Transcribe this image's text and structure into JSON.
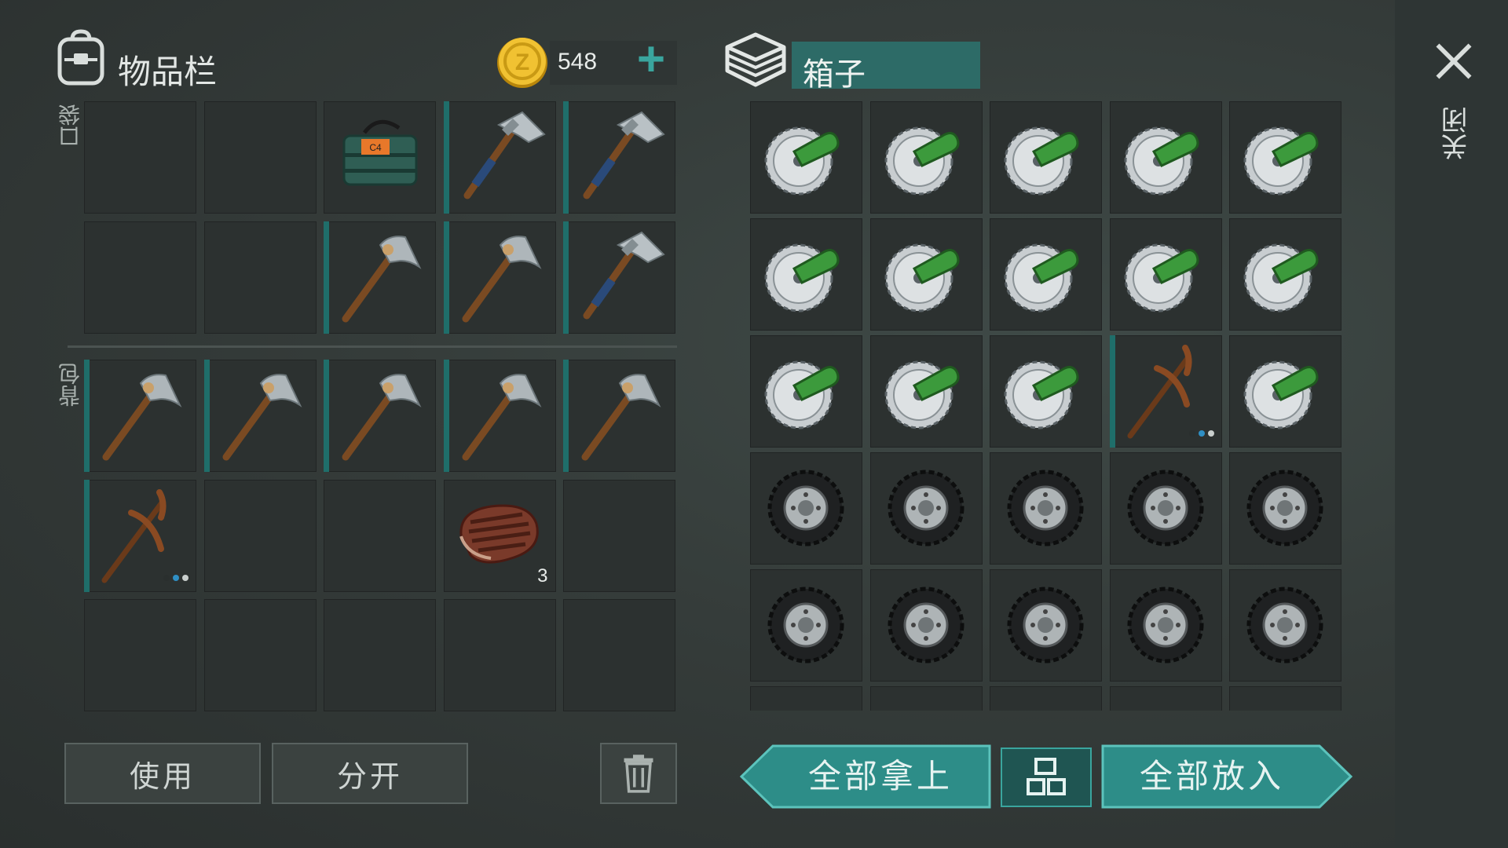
{
  "inventory": {
    "title": "物品栏",
    "coins": "548",
    "add_label": "+",
    "pocket_label": "口袋",
    "backpack_label": "背包",
    "pocket_slots": [
      {
        "item": ""
      },
      {
        "item": ""
      },
      {
        "item": "c4-explosive-icon"
      },
      {
        "item": "axe-icon",
        "marked": true
      },
      {
        "item": "axe-icon",
        "marked": true
      },
      {
        "item": ""
      },
      {
        "item": ""
      },
      {
        "item": "stone-pickaxe-icon",
        "marked": true
      },
      {
        "item": "stone-pickaxe-icon",
        "marked": true
      },
      {
        "item": "axe-icon",
        "marked": true
      }
    ],
    "backpack_slots": [
      {
        "item": "stone-pickaxe-icon",
        "marked": true
      },
      {
        "item": "stone-pickaxe-icon",
        "marked": true
      },
      {
        "item": "stone-pickaxe-icon",
        "marked": true
      },
      {
        "item": "stone-pickaxe-icon",
        "marked": true
      },
      {
        "item": "stone-pickaxe-icon",
        "marked": true
      },
      {
        "item": "pickaxe-icon",
        "marked": true,
        "dots": true
      },
      {
        "item": ""
      },
      {
        "item": ""
      },
      {
        "item": "steak-icon",
        "qty": "3"
      },
      {
        "item": ""
      },
      {
        "item": ""
      },
      {
        "item": ""
      },
      {
        "item": ""
      },
      {
        "item": ""
      },
      {
        "item": ""
      }
    ],
    "use_label": "使用",
    "split_label": "分开"
  },
  "box": {
    "title": "箱子",
    "slots": [
      {
        "item": "saw-blade-icon"
      },
      {
        "item": "saw-blade-icon"
      },
      {
        "item": "saw-blade-icon"
      },
      {
        "item": "saw-blade-icon"
      },
      {
        "item": "saw-blade-icon"
      },
      {
        "item": "saw-blade-icon"
      },
      {
        "item": "saw-blade-icon"
      },
      {
        "item": "saw-blade-icon"
      },
      {
        "item": "saw-blade-icon"
      },
      {
        "item": "saw-blade-icon"
      },
      {
        "item": "saw-blade-icon"
      },
      {
        "item": "saw-blade-icon"
      },
      {
        "item": "saw-blade-icon"
      },
      {
        "item": "pickaxe-icon",
        "marked": true,
        "dots": true
      },
      {
        "item": "saw-blade-icon"
      },
      {
        "item": "tire-icon"
      },
      {
        "item": "tire-icon"
      },
      {
        "item": "tire-icon"
      },
      {
        "item": "tire-icon"
      },
      {
        "item": "tire-icon"
      },
      {
        "item": "tire-icon"
      },
      {
        "item": "tire-icon"
      },
      {
        "item": "tire-icon"
      },
      {
        "item": "tire-icon"
      },
      {
        "item": "tire-icon"
      }
    ],
    "take_all_label": "全部拿上",
    "put_all_label": "全部放入"
  },
  "close_label": "关闭",
  "colors": {
    "accent": "#3aa59e",
    "slot": "#2c3130",
    "marker": "#1f6e6a"
  }
}
